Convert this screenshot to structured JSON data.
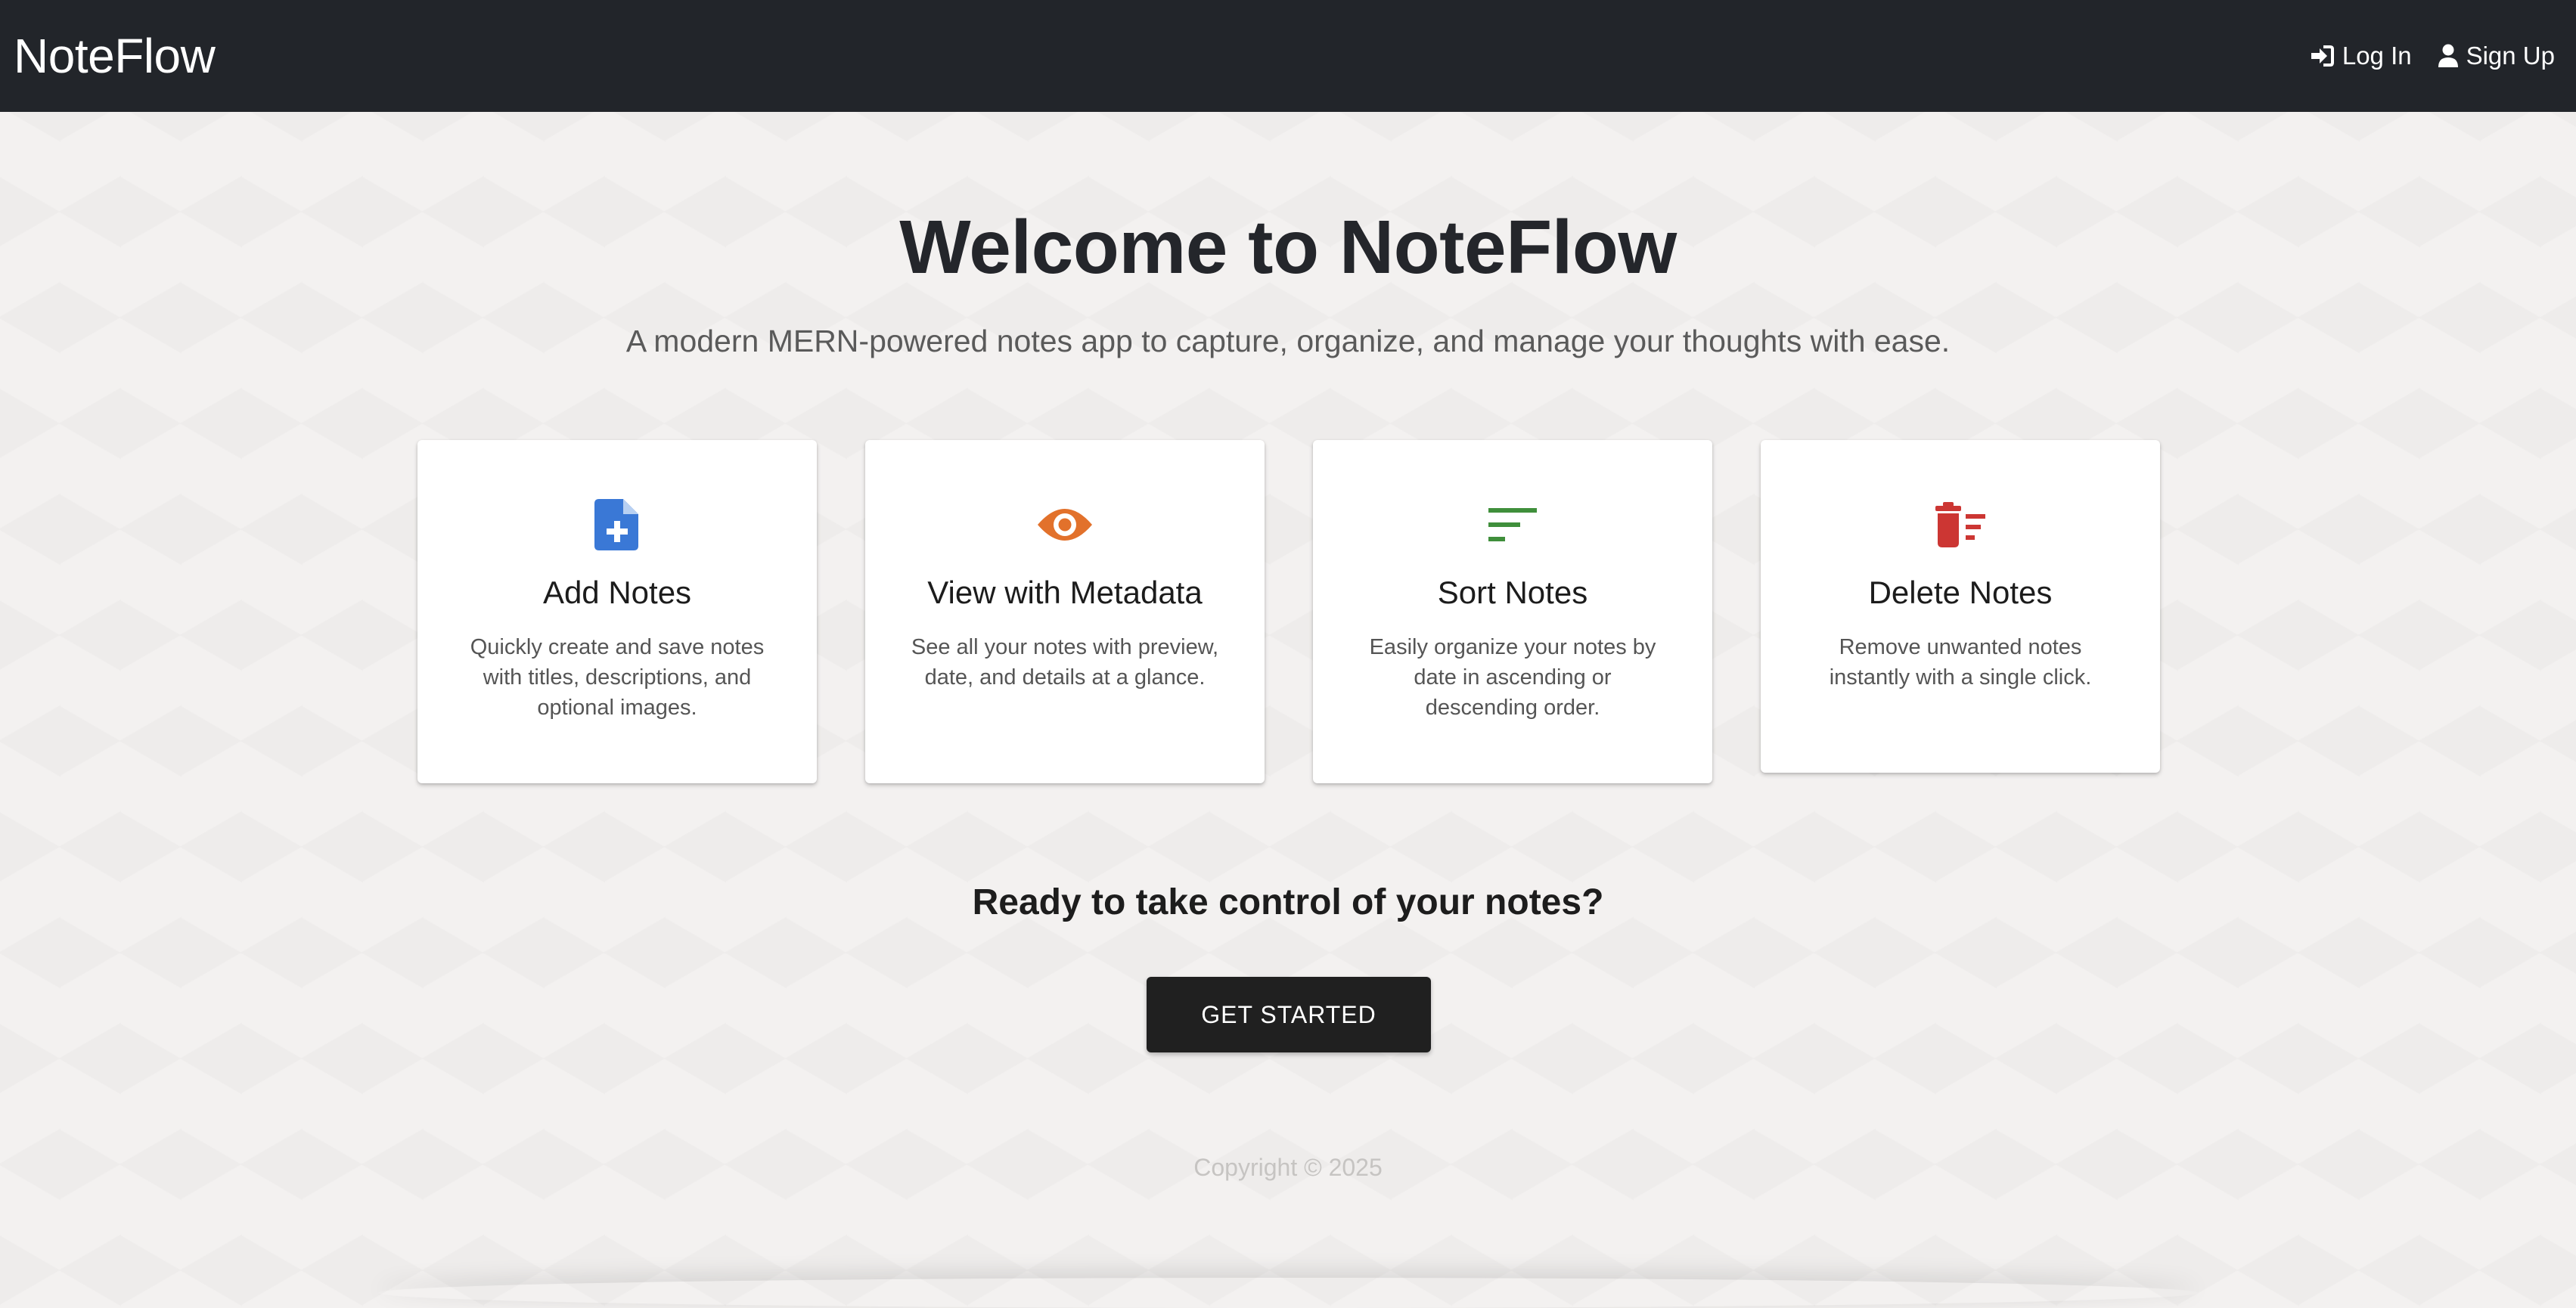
{
  "navbar": {
    "brand": "NoteFlow",
    "login_label": "Log In",
    "signup_label": "Sign Up",
    "icons": {
      "login": "login-arrow-icon",
      "signup": "user-icon"
    }
  },
  "hero": {
    "title": "Welcome to NoteFlow",
    "subtitle": "A modern MERN-powered notes app to capture, organize, and manage your thoughts with ease."
  },
  "features": [
    {
      "icon": "file-plus-icon",
      "icon_color": "#3a78d6",
      "title": "Add Notes",
      "description": "Quickly create and save notes with titles, descriptions, and optional images."
    },
    {
      "icon": "eye-icon",
      "icon_color": "#e2712b",
      "title": "View with Metadata",
      "description": "See all your notes with preview, date, and details at a glance."
    },
    {
      "icon": "sort-icon",
      "icon_color": "#3f8f3b",
      "title": "Sort Notes",
      "description": "Easily organize your notes by date in ascending or descending order."
    },
    {
      "icon": "delete-sweep-icon",
      "icon_color": "#cc3633",
      "title": "Delete Notes",
      "description": "Remove unwanted notes instantly with a single click."
    }
  ],
  "cta": {
    "heading": "Ready to take control of your notes?",
    "button_label": "GET STARTED"
  },
  "footer": {
    "copyright": "Copyright © 2025"
  }
}
